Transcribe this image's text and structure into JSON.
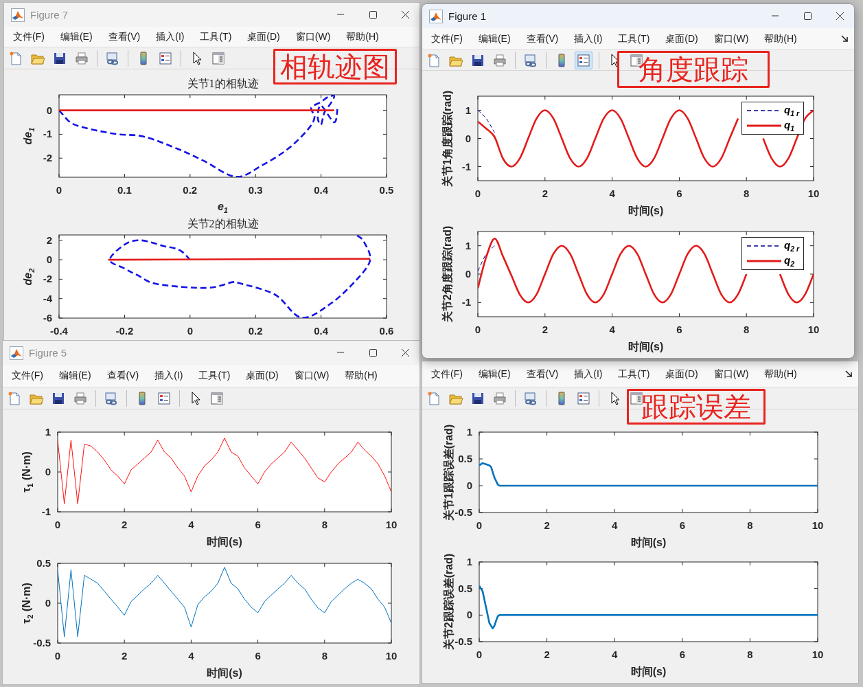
{
  "figures": [
    {
      "title": "Figure 7",
      "active": false,
      "dock_button": false,
      "annotation": "相轨迹图",
      "menu": [
        "文件(F)",
        "编辑(E)",
        "查看(V)",
        "插入(I)",
        "工具(T)",
        "桌面(D)",
        "窗口(W)",
        "帮助(H)"
      ],
      "toolbar": [
        {
          "kind": "new",
          "pressed": false
        },
        {
          "kind": "open",
          "pressed": false
        },
        {
          "kind": "save",
          "pressed": false
        },
        {
          "kind": "print",
          "pressed": false
        },
        {
          "kind": "link",
          "pressed": false
        },
        {
          "kind": "colorbar",
          "pressed": false
        },
        {
          "kind": "legend",
          "pressed": false
        },
        {
          "kind": "pointer",
          "pressed": false
        },
        {
          "kind": "inspector",
          "pressed": false
        }
      ],
      "axes": [
        {
          "chart_data": {
            "type": "line",
            "title": "关节1的相轨迹",
            "xlabel": "e$_{1}$",
            "ylabel": "de$_{1}$",
            "xlim": [
              0,
              0.5
            ],
            "ylim": [
              -2.8,
              0.65
            ],
            "xticks": [
              0,
              0.1,
              0.2,
              0.3,
              0.4,
              0.5
            ],
            "yticks": [
              -2,
              -1,
              0
            ],
            "series": [
              {
                "color": "#1414e6",
                "line_style": "dashed",
                "x": [
                  0,
                  0.005,
                  0.02,
                  0.05,
                  0.09,
                  0.13,
                  0.18,
                  0.22,
                  0.27,
                  0.31,
                  0.35,
                  0.38,
                  0.39,
                  0.385,
                  0.4,
                  0.41,
                  0.42,
                  0.415,
                  0.405,
                  0.4,
                  0.395,
                  0.4,
                  0.42,
                  0.425
                ],
                "values": [
                  0,
                  -0.15,
                  -0.55,
                  -0.8,
                  -1.0,
                  -1.1,
                  -1.6,
                  -2.1,
                  -2.78,
                  -2.3,
                  -1.6,
                  -0.8,
                  -0.3,
                  0.1,
                  0.35,
                  0.55,
                  0.6,
                  0.3,
                  -0.1,
                  -0.6,
                  -0.3,
                  0.2,
                  -0.5,
                  0.05
                ]
              },
              {
                "color": "#e41a1a",
                "line_style": "solid",
                "x": [
                  0,
                  0.42
                ],
                "values": [
                  0,
                  0
                ]
              }
            ]
          }
        },
        {
          "chart_data": {
            "type": "line",
            "title": "关节2的相轨迹",
            "ylabel": "de$_{2}$",
            "xlim": [
              -0.4,
              0.6
            ],
            "ylim": [
              -6,
              2.55
            ],
            "xticks": [
              -0.4,
              -0.2,
              0,
              0.2,
              0.4,
              0.6
            ],
            "yticks": [
              -6,
              -4,
              -2,
              0,
              2
            ],
            "series": [
              {
                "color": "#1414e6",
                "line_style": "dashed",
                "x": [
                  0.51,
                  0.53,
                  0.55,
                  0.51,
                  0.43,
                  0.34,
                  0.26,
                  0.15,
                  0.13,
                  0.05,
                  -0.1,
                  -0.16,
                  -0.2,
                  -0.245,
                  -0.2,
                  -0.16,
                  -0.12,
                  -0.08,
                  -0.05,
                  -0.025,
                  0
                ],
                "values": [
                  2.5,
                  1.9,
                  0,
                  -2,
                  -4.5,
                  -5.95,
                  -3.6,
                  -2.4,
                  -2.3,
                  -2.9,
                  -2.5,
                  -1.6,
                  -0.9,
                  0,
                  1.56,
                  2,
                  1.8,
                  1.4,
                  1.2,
                  0.85,
                  0
                ]
              },
              {
                "color": "#e41a1a",
                "line_style": "solid",
                "x": [
                  -0.25,
                  0.55
                ],
                "values": [
                  0,
                  0.1
                ]
              }
            ]
          }
        }
      ]
    },
    {
      "title": "Figure 1",
      "active": true,
      "dock_button": true,
      "annotation": "角度跟踪",
      "menu": [
        "文件(F)",
        "编辑(E)",
        "查看(V)",
        "插入(I)",
        "工具(T)",
        "桌面(D)",
        "窗口(W)",
        "帮助(H)"
      ],
      "toolbar": [
        {
          "kind": "new",
          "pressed": false
        },
        {
          "kind": "open",
          "pressed": false
        },
        {
          "kind": "save",
          "pressed": false
        },
        {
          "kind": "print",
          "pressed": false
        },
        {
          "kind": "link",
          "pressed": false
        },
        {
          "kind": "colorbar",
          "pressed": false
        },
        {
          "kind": "legend",
          "pressed": true
        },
        {
          "kind": "pointer",
          "pressed": false
        },
        {
          "kind": "inspector",
          "pressed": false
        }
      ],
      "axes": [
        {
          "chart_data": {
            "type": "line",
            "xlabel": "时间(s)",
            "ylabel": "关节1角度跟踪(rad)",
            "legend": "upper right",
            "xlim": [
              0,
              10
            ],
            "ylim": [
              -1.5,
              1.5
            ],
            "xticks": [
              0,
              2,
              4,
              6,
              8,
              10
            ],
            "yticks": [
              -1,
              0,
              1
            ],
            "series": [
              {
                "name": "q$_{1 r}$",
                "color": "#00008b",
                "line_style": "dashed",
                "x": [
                  0,
                  0.25,
                  0.5
                ],
                "values": [
                  1,
                  0.71,
                  0.2
                ]
              },
              {
                "name": "q$_{1}$",
                "color": "#e41a1a",
                "line_style": "solid",
                "x": [
                  0,
                  0.25,
                  0.5,
                  0.75,
                  1,
                  1.25,
                  1.5,
                  1.75,
                  2,
                  2.25,
                  2.5,
                  2.75,
                  3,
                  3.25,
                  3.5,
                  3.75,
                  4,
                  4.25,
                  4.5,
                  4.75,
                  5,
                  5.25,
                  5.5,
                  5.75,
                  6,
                  6.25,
                  6.5,
                  6.75,
                  7,
                  7.25,
                  7.5,
                  7.75,
                  8.5,
                  8.75,
                  9,
                  9.25,
                  9.5,
                  9.75,
                  10
                ],
                "values": [
                  0.6,
                  0.35,
                  0.05,
                  -0.72,
                  -1,
                  -0.71,
                  0,
                  0.71,
                  1,
                  0.71,
                  0,
                  -0.71,
                  -1,
                  -0.71,
                  0,
                  0.71,
                  1,
                  0.71,
                  0,
                  -0.71,
                  -1,
                  -0.71,
                  0,
                  0.71,
                  1,
                  0.71,
                  0,
                  -0.71,
                  -1,
                  -0.71,
                  0,
                  0.71,
                  0,
                  -0.71,
                  -1,
                  -0.71,
                  0,
                  0.71,
                  1
                ]
              }
            ]
          }
        },
        {
          "chart_data": {
            "type": "line",
            "xlabel": "时间(s)",
            "ylabel": "关节2角度跟踪(rad)",
            "legend": "upper right",
            "xlim": [
              0,
              10
            ],
            "ylim": [
              -1.5,
              1.5
            ],
            "xticks": [
              0,
              2,
              4,
              6,
              8,
              10
            ],
            "yticks": [
              -1,
              0,
              1
            ],
            "series": [
              {
                "name": "q$_{2 r}$",
                "color": "#00008b",
                "line_style": "dashed",
                "x": [
                  0,
                  0.25,
                  0.5
                ],
                "values": [
                  0.1,
                  0.71,
                  1
                ]
              },
              {
                "name": "q$_{2}$",
                "color": "#e41a1a",
                "line_style": "solid",
                "x": [
                  0,
                  0.25,
                  0.5,
                  0.75,
                  1,
                  1.25,
                  1.5,
                  1.75,
                  2,
                  2.25,
                  2.5,
                  2.75,
                  3,
                  3.25,
                  3.5,
                  3.75,
                  4,
                  4.25,
                  4.5,
                  4.75,
                  5,
                  5.25,
                  5.5,
                  5.75,
                  6,
                  6.25,
                  6.5,
                  6.75,
                  7,
                  7.25,
                  7.5,
                  7.75,
                  8,
                  9,
                  9.25,
                  9.5,
                  9.75,
                  10
                ],
                "values": [
                  -0.5,
                  0.6,
                  1.25,
                  0.62,
                  -0.05,
                  -0.72,
                  -1,
                  -0.71,
                  0,
                  0.71,
                  1,
                  0.71,
                  0,
                  -0.71,
                  -1,
                  -0.71,
                  0,
                  0.71,
                  1,
                  0.71,
                  0,
                  -0.71,
                  -1,
                  -0.71,
                  0,
                  0.71,
                  1,
                  0.71,
                  0,
                  -0.71,
                  -1,
                  -0.71,
                  0,
                  0,
                  -0.71,
                  -1,
                  -0.71,
                  0
                ]
              }
            ]
          }
        }
      ]
    },
    {
      "title": "Figure 5",
      "active": false,
      "dock_button": false,
      "menu": [
        "文件(F)",
        "编辑(E)",
        "查看(V)",
        "插入(I)",
        "工具(T)",
        "桌面(D)",
        "窗口(W)",
        "帮助(H)"
      ],
      "toolbar": [
        {
          "kind": "new",
          "pressed": false
        },
        {
          "kind": "open",
          "pressed": false
        },
        {
          "kind": "save",
          "pressed": false
        },
        {
          "kind": "print",
          "pressed": false
        },
        {
          "kind": "link",
          "pressed": false
        },
        {
          "kind": "colorbar",
          "pressed": false
        },
        {
          "kind": "legend",
          "pressed": false
        },
        {
          "kind": "pointer",
          "pressed": false
        },
        {
          "kind": "inspector",
          "pressed": false
        }
      ],
      "axes": [
        {
          "chart_data": {
            "type": "line",
            "xlabel": "时间(s)",
            "ylabel": "τ$_{1}$ (N·m)",
            "xlim": [
              0,
              10
            ],
            "ylim": [
              -1,
              1
            ],
            "xticks": [
              0,
              2,
              4,
              6,
              8,
              10
            ],
            "yticks": [
              -1,
              0,
              1
            ],
            "x": [
              0,
              0.2,
              0.4,
              0.6,
              0.8,
              1,
              1.2,
              1.4,
              1.6,
              1.8,
              2,
              2.2,
              2.4,
              2.6,
              2.8,
              3,
              3.2,
              3.4,
              3.6,
              3.8,
              4,
              4.2,
              4.4,
              4.6,
              4.8,
              5,
              5.2,
              5.4,
              5.6,
              5.8,
              6,
              6.2,
              6.4,
              6.6,
              6.8,
              7,
              7.2,
              7.4,
              7.6,
              7.8,
              8,
              8.2,
              8.4,
              8.6,
              8.8,
              9,
              9.2,
              9.4,
              9.6,
              9.8,
              10
            ],
            "series": [
              {
                "color": "#ff1010",
                "line_style": "solid",
                "values": [
                  0.8,
                  -0.8,
                  0.8,
                  -0.8,
                  0.7,
                  0.65,
                  0.5,
                  0.3,
                  0.05,
                  -0.1,
                  -0.3,
                  0.05,
                  0.2,
                  0.35,
                  0.5,
                  0.8,
                  0.5,
                  0.35,
                  0.1,
                  -0.1,
                  -0.5,
                  -0.1,
                  0.15,
                  0.3,
                  0.5,
                  0.85,
                  0.5,
                  0.4,
                  0.1,
                  -0.1,
                  -0.3,
                  0,
                  0.2,
                  0.35,
                  0.5,
                  0.75,
                  0.55,
                  0.35,
                  0.1,
                  -0.15,
                  -0.25,
                  0,
                  0.2,
                  0.35,
                  0.5,
                  0.75,
                  0.55,
                  0.4,
                  0.2,
                  -0.1,
                  -0.5
                ]
              }
            ]
          }
        },
        {
          "chart_data": {
            "type": "line",
            "xlabel": "时间(s)",
            "ylabel": "τ$_{2}$ (N·m)",
            "xlim": [
              0,
              10
            ],
            "ylim": [
              -0.5,
              0.5
            ],
            "xticks": [
              0,
              2,
              4,
              6,
              8,
              10
            ],
            "yticks": [
              -0.5,
              0,
              0.5
            ],
            "x": [
              0,
              0.2,
              0.4,
              0.6,
              0.8,
              1,
              1.2,
              1.4,
              1.6,
              1.8,
              2,
              2.2,
              2.4,
              2.6,
              2.8,
              3,
              3.2,
              3.4,
              3.6,
              3.8,
              4,
              4.2,
              4.4,
              4.6,
              4.8,
              5,
              5.2,
              5.4,
              5.6,
              5.8,
              6,
              6.2,
              6.4,
              6.6,
              6.8,
              7,
              7.2,
              7.4,
              7.6,
              7.8,
              8,
              8.2,
              8.4,
              8.6,
              8.8,
              9,
              9.2,
              9.4,
              9.6,
              9.8,
              10
            ],
            "series": [
              {
                "color": "#0072bd",
                "line_style": "solid",
                "values": [
                  0.42,
                  -0.42,
                  0.42,
                  -0.42,
                  0.35,
                  0.3,
                  0.25,
                  0.15,
                  0.05,
                  -0.05,
                  -0.15,
                  0.02,
                  0.1,
                  0.18,
                  0.25,
                  0.35,
                  0.25,
                  0.15,
                  0.05,
                  -0.05,
                  -0.3,
                  -0.02,
                  0.08,
                  0.15,
                  0.25,
                  0.45,
                  0.25,
                  0.18,
                  0.05,
                  -0.05,
                  -0.12,
                  0.02,
                  0.1,
                  0.18,
                  0.25,
                  0.35,
                  0.25,
                  0.18,
                  0.05,
                  -0.06,
                  -0.12,
                  0.02,
                  0.1,
                  0.18,
                  0.25,
                  0.3,
                  0.25,
                  0.18,
                  0.05,
                  -0.05,
                  -0.25
                ]
              }
            ]
          }
        }
      ]
    },
    {
      "dock_button": true,
      "annotation": "跟踪误差",
      "menu": [
        "文件(F)",
        "编辑(E)",
        "查看(V)",
        "插入(I)",
        "工具(T)",
        "桌面(D)",
        "窗口(W)",
        "帮助(H)"
      ],
      "toolbar": [
        {
          "kind": "new",
          "pressed": false
        },
        {
          "kind": "open",
          "pressed": false
        },
        {
          "kind": "save",
          "pressed": false
        },
        {
          "kind": "print",
          "pressed": false
        },
        {
          "kind": "link",
          "pressed": false
        },
        {
          "kind": "colorbar",
          "pressed": false
        },
        {
          "kind": "legend",
          "pressed": false
        },
        {
          "kind": "pointer",
          "pressed": false
        },
        {
          "kind": "inspector",
          "pressed": false
        }
      ],
      "axes": [
        {
          "chart_data": {
            "type": "line",
            "xlabel": "时间(s)",
            "ylabel": "关节1跟踪误差(rad)",
            "xlim": [
              0,
              10
            ],
            "ylim": [
              -0.5,
              1
            ],
            "xticks": [
              0,
              2,
              4,
              6,
              8,
              10
            ],
            "yticks": [
              -0.5,
              0,
              0.5,
              1
            ],
            "series": [
              {
                "color": "#0072bd",
                "line_style": "solid",
                "x": [
                  0,
                  0.1,
                  0.2,
                  0.3,
                  0.35,
                  0.45,
                  0.55,
                  0.6,
                  1,
                  10
                ],
                "values": [
                  0.38,
                  0.42,
                  0.4,
                  0.38,
                  0.35,
                  0.15,
                  0.02,
                  0,
                  0,
                  0
                ]
              }
            ]
          }
        },
        {
          "chart_data": {
            "type": "line",
            "xlabel": "时间(s)",
            "ylabel": "关节2跟踪误差(rad)",
            "xlim": [
              0,
              10
            ],
            "ylim": [
              -0.5,
              1
            ],
            "xticks": [
              0,
              2,
              4,
              6,
              8,
              10
            ],
            "yticks": [
              -0.5,
              0,
              0.5,
              1
            ],
            "series": [
              {
                "color": "#0072bd",
                "line_style": "solid",
                "x": [
                  0,
                  0.1,
                  0.2,
                  0.3,
                  0.4,
                  0.45,
                  0.5,
                  0.55,
                  0.6,
                  1,
                  10
                ],
                "values": [
                  0.55,
                  0.45,
                  0.15,
                  -0.15,
                  -0.25,
                  -0.2,
                  -0.1,
                  -0.02,
                  0,
                  0,
                  0
                ]
              }
            ]
          }
        }
      ]
    }
  ]
}
